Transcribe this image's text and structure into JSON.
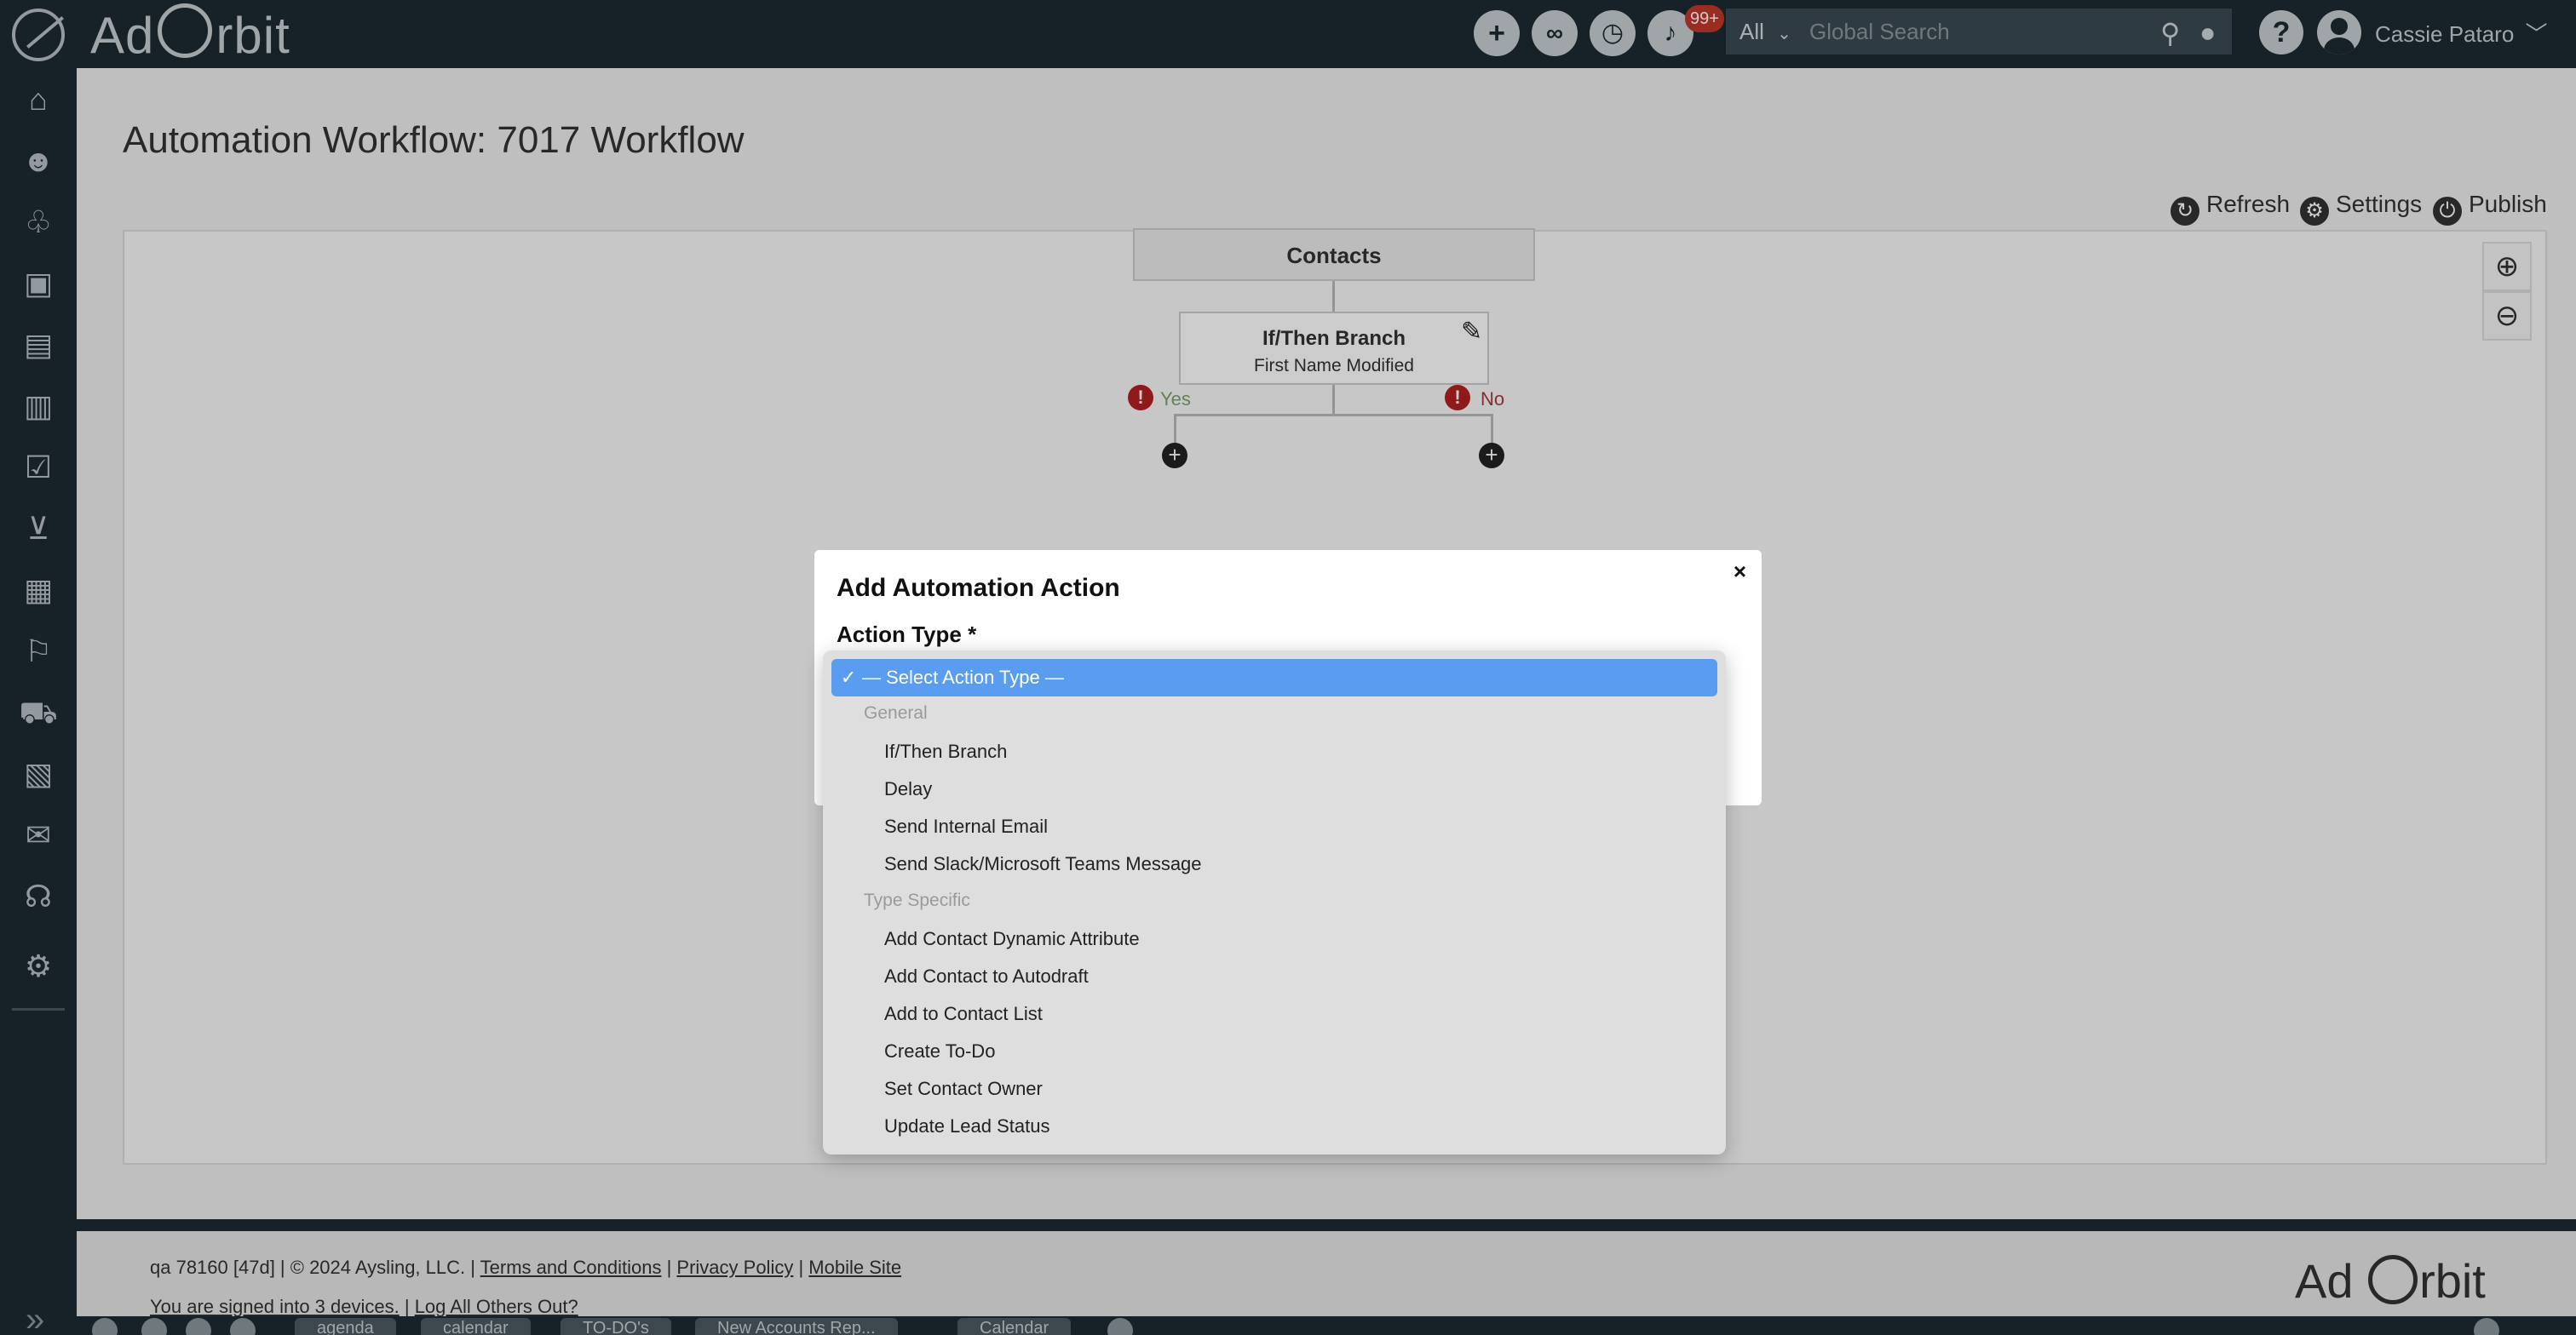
{
  "header": {
    "logo_text": "Ad Orbit",
    "badge": "99+",
    "search_scope": "All",
    "search_placeholder": "Global Search",
    "user_name": "Cassie Pataro"
  },
  "page": {
    "title": "Automation Workflow: 7017 Workflow",
    "toolbar": {
      "refresh": "Refresh",
      "settings": "Settings",
      "publish": "Publish"
    }
  },
  "workflow": {
    "root": "Contacts",
    "branch_title": "If/Then Branch",
    "branch_sub": "First Name Modified",
    "yes": "Yes",
    "no": "No"
  },
  "modal": {
    "title": "Add Automation Action",
    "close": "×",
    "label": "Action Type *",
    "selected": "— Select Action Type —",
    "groups": [
      {
        "label": "General",
        "items": [
          "If/Then Branch",
          "Delay",
          "Send Internal Email",
          "Send Slack/Microsoft Teams Message"
        ]
      },
      {
        "label": "Type Specific",
        "items": [
          "Add Contact Dynamic Attribute",
          "Add Contact to Autodraft",
          "Add to Contact List",
          "Create To-Do",
          "Set Contact Owner",
          "Update Lead Status"
        ]
      }
    ]
  },
  "footer": {
    "version": "qa 78160 [47d] | © 2024 Aysling, LLC. |",
    "terms": "Terms and Conditions",
    "privacy": "Privacy Policy",
    "mobile": "Mobile Site",
    "signed_in": "You are signed into 3 devices.",
    "logout_others": "Log All Others Out?",
    "logo_text": "Ad Orbit",
    "tabs": [
      "agenda",
      "calendar",
      "TO-DO's",
      "New Accounts Rep...",
      "Calendar"
    ]
  }
}
